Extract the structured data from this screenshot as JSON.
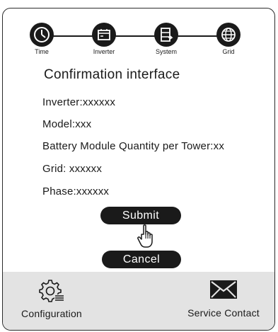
{
  "stepper": {
    "steps": [
      {
        "label": "Time",
        "icon": "clock-icon"
      },
      {
        "label": "Inverter",
        "icon": "inverter-icon"
      },
      {
        "label": "System",
        "icon": "system-icon"
      },
      {
        "label": "Grid",
        "icon": "globe-icon"
      }
    ]
  },
  "main": {
    "title": "Confirmation interface",
    "lines": {
      "inverter": "Inverter:xxxxxx",
      "model": "Model:xxx",
      "battery": "Battery Module Quantity per Tower:xx",
      "grid": "Grid: xxxxxx",
      "phase": "Phase:xxxxxx"
    },
    "submit_label": "Submit",
    "cancel_label": "Cancel"
  },
  "footer": {
    "configuration_label": "Configuration",
    "service_contact_label": "Service Contact"
  },
  "colors": {
    "dark": "#1a1a1a",
    "footer_bg": "#e3e3e3",
    "background": "#ffffff"
  }
}
